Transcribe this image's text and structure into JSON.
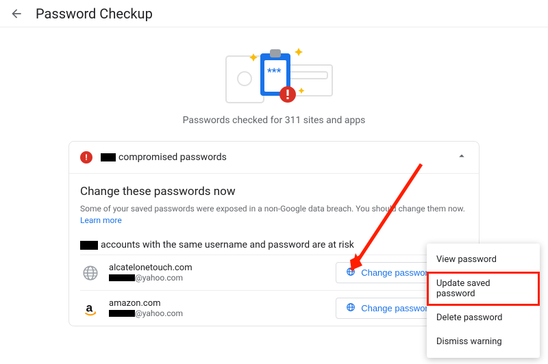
{
  "header": {
    "title": "Password Checkup"
  },
  "hero": {
    "subtitle": "Passwords checked for 311 sites and apps"
  },
  "compromised": {
    "title_suffix": "compromised passwords",
    "heading": "Change these passwords now",
    "description": "Some of your saved passwords were exposed in a non-Google data breach. You should change them now.",
    "learn_more": "Learn more",
    "risk_suffix": "accounts with the same username and password are at risk",
    "change_label": "Change password",
    "accounts": [
      {
        "site": "alcatelonetouch.com",
        "email_suffix": "@yahoo.com",
        "icon": "globe"
      },
      {
        "site": "amazon.com",
        "email_suffix": "@yahoo.com",
        "icon": "amazon"
      }
    ]
  },
  "menu": {
    "view": "View password",
    "update": "Update saved password",
    "delete": "Delete password",
    "dismiss": "Dismiss warning"
  }
}
